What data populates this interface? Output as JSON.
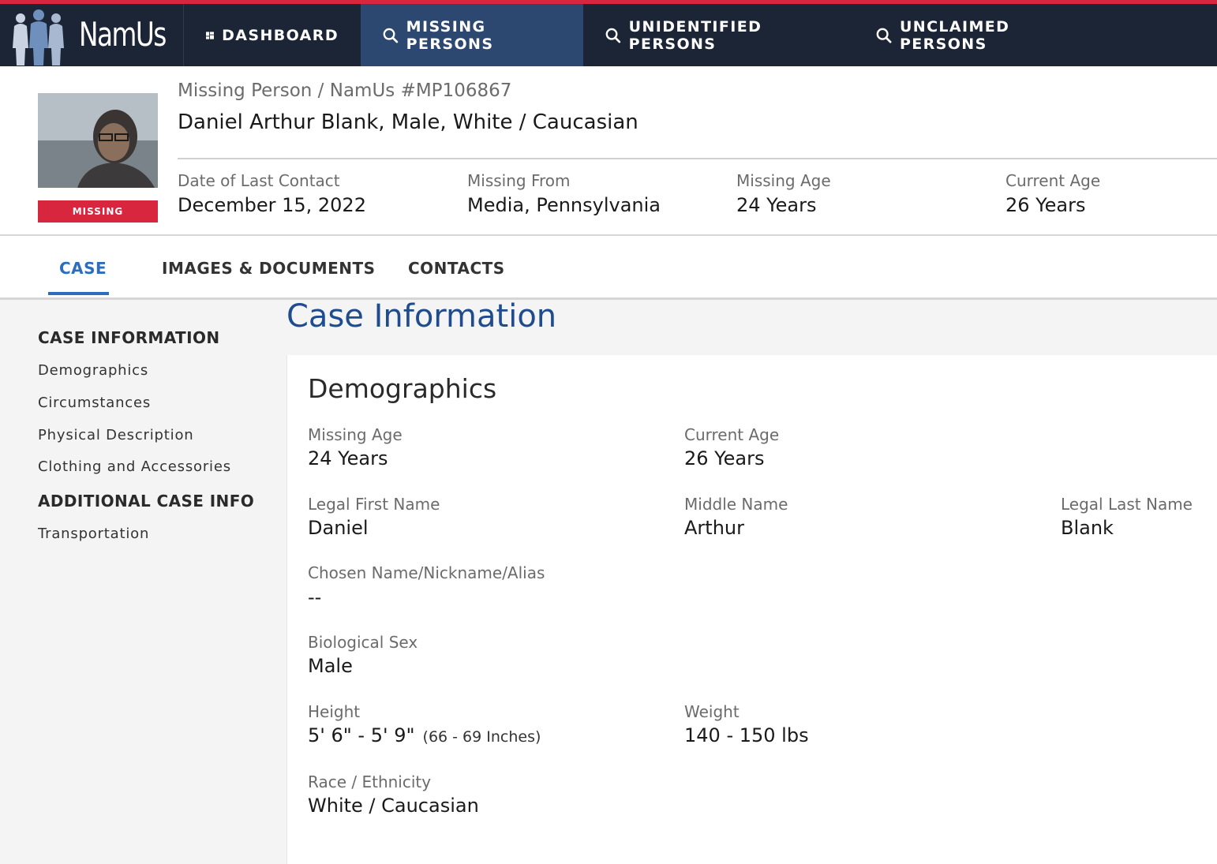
{
  "nav": {
    "logo_text": "NamUs",
    "items": [
      {
        "label": "DASHBOARD",
        "icon": "dashboard-icon"
      },
      {
        "label": "MISSING PERSONS",
        "icon": "search-icon"
      },
      {
        "label": "UNIDENTIFIED PERSONS",
        "icon": "search-icon"
      },
      {
        "label": "UNCLAIMED PERSONS",
        "icon": "search-icon"
      }
    ],
    "active_index": 1
  },
  "person": {
    "status": "MISSING",
    "case_ref": "Missing Person / NamUs #MP106867",
    "title": "Daniel Arthur Blank, Male, White / Caucasian",
    "summary": [
      {
        "label": "Date of Last Contact",
        "value": "December 15, 2022"
      },
      {
        "label": "Missing From",
        "value": "Media, Pennsylvania"
      },
      {
        "label": "Missing Age",
        "value": "24 Years"
      },
      {
        "label": "Current Age",
        "value": "26 Years"
      }
    ]
  },
  "tabs": [
    {
      "label": "CASE",
      "active": true
    },
    {
      "label": "IMAGES & DOCUMENTS",
      "active": false
    },
    {
      "label": "CONTACTS",
      "active": false
    }
  ],
  "sidenav": {
    "sections": [
      {
        "heading": "CASE INFORMATION",
        "links": [
          "Demographics",
          "Circumstances",
          "Physical Description",
          "Clothing and Accessories"
        ]
      },
      {
        "heading": "ADDITIONAL CASE INFO",
        "links": [
          "Transportation"
        ]
      }
    ]
  },
  "page": {
    "title": "Case Information",
    "card_title": "Demographics"
  },
  "demographics": {
    "missing_age": {
      "label": "Missing Age",
      "value": "24 Years"
    },
    "current_age": {
      "label": "Current Age",
      "value": "26 Years"
    },
    "first_name": {
      "label": "Legal First Name",
      "value": "Daniel"
    },
    "middle_name": {
      "label": "Middle Name",
      "value": "Arthur"
    },
    "last_name": {
      "label": "Legal Last Name",
      "value": "Blank"
    },
    "alias": {
      "label": "Chosen Name/Nickname/Alias",
      "value": "--"
    },
    "sex": {
      "label": "Biological Sex",
      "value": "Male"
    },
    "height": {
      "label": "Height",
      "value": "5' 6\" - 5' 9\"",
      "sub": "(66 - 69 Inches)"
    },
    "weight": {
      "label": "Weight",
      "value": "140 - 150 lbs"
    },
    "race": {
      "label": "Race / Ethnicity",
      "value": "White / Caucasian"
    }
  },
  "colors": {
    "nav_bg": "#1b2536",
    "nav_active": "#2c4770",
    "accent_red": "#d7263d",
    "link_blue": "#2d6dc0",
    "title_blue": "#1f4b8f"
  }
}
